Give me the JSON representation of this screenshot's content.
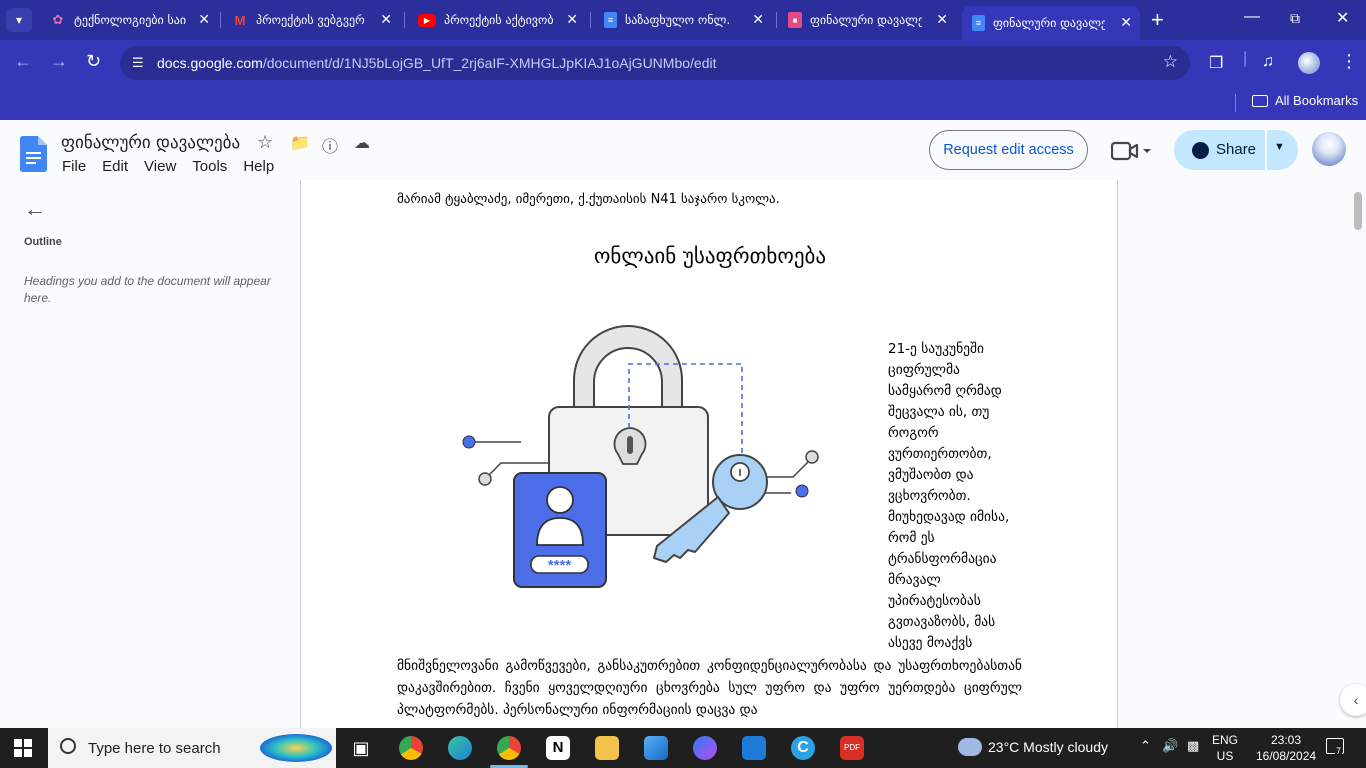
{
  "browser": {
    "tabs": [
      {
        "title": "ტექნოლოგიები საი",
        "favicon": "pink-flower-icon",
        "color": "#e06aa8"
      },
      {
        "title": "პროექტის ვებგვერ",
        "favicon": "gmail-icon",
        "color": "#ea4335"
      },
      {
        "title": "პროექტის აქტივობ",
        "favicon": "youtube-icon",
        "color": "#ff0000"
      },
      {
        "title": "საზაფხულო ონლ.",
        "favicon": "docs-icon",
        "color": "#4285f4"
      },
      {
        "title": "ფინალური დავალე",
        "favicon": "slides-icon",
        "color": "#e34a85"
      },
      {
        "title": "ფინალური დავალე",
        "favicon": "docs-icon",
        "color": "#4285f4"
      }
    ],
    "url_host": "docs.google.com",
    "url_path": "/document/d/1NJ5bLojGB_UfT_2rj6aIF-XMHGLJpKIAJ1oAjGUNMbo/edit",
    "bookmarks_label": "All Bookmarks"
  },
  "docs": {
    "title": "ფინალური დავალება",
    "menu": [
      "File",
      "Edit",
      "View",
      "Tools",
      "Help"
    ],
    "request_edit_label": "Request edit access",
    "share_label": "Share"
  },
  "outline": {
    "label": "Outline",
    "hint": "Headings you add to the document will appear here."
  },
  "document": {
    "byline": "მარიამ ტყაბლაძე, იმერეთი, ქ.ქუთაისის N41 საჯარო სკოლა.",
    "heading": "ონლაინ უსაფრთხოება",
    "side_text": "21-ე საუკუნეში ციფრულმა სამყარომ ღრმად შეცვალა ის, თუ როგორ ვურთიერთობთ, ვმუშაობთ და ვცხოვრობთ. მიუხედავად იმისა, რომ ეს ტრანსფორმაცია მრავალ უპირატესობას გვთავაზობს, მას ასევე მოაქვს",
    "body_text": "მნიშვნელოვანი გამოწვევები, განსაკუთრებით კონფიდენციალურობასა და უსაფრთხოებასთან დაკავშირებით. ჩვენი ყოველდღიური ცხოვრება სულ უფრო და უფრო უერთდება ციფრულ პლატფორმებს. პერსონალური ინფორმაციის დაცვა და",
    "password_mask": "****"
  },
  "taskbar": {
    "search_placeholder": "Type here to search",
    "weather": "23°C  Mostly cloudy",
    "lang_top": "ENG",
    "lang_bottom": "US",
    "time": "23:03",
    "date": "16/08/2024",
    "notifications_count": "7"
  }
}
